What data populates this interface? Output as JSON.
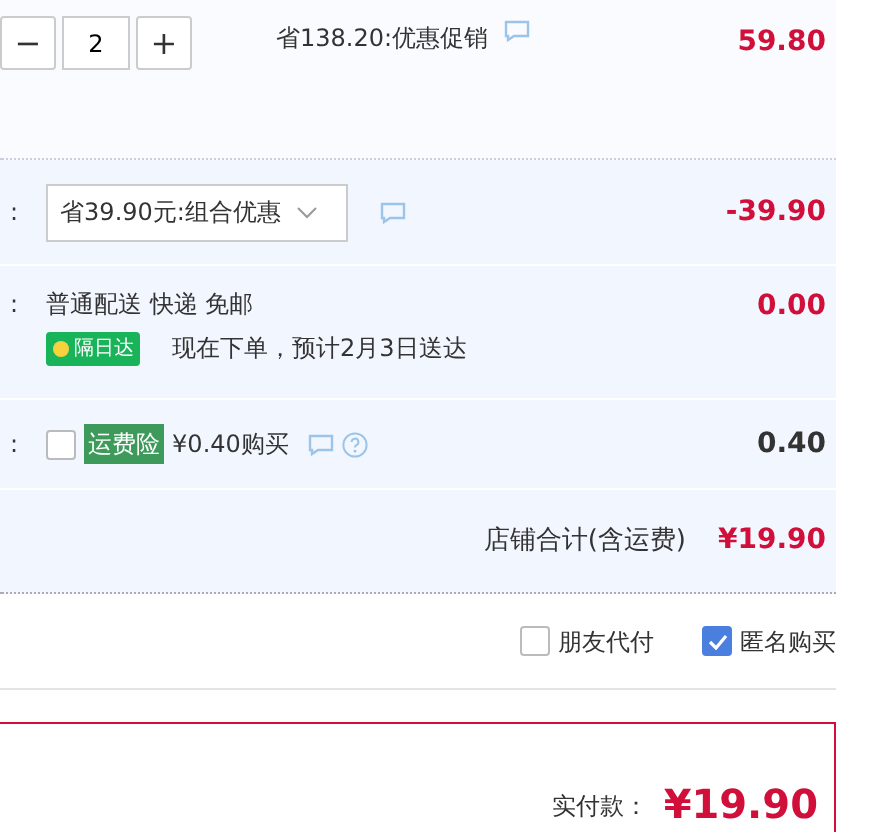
{
  "item": {
    "minus": "−",
    "quantity": "2",
    "plus": "+",
    "promo": "省138.20:优惠促销",
    "price": "59.80"
  },
  "combo": {
    "colon": ":",
    "selection": "省39.90元:组合优惠",
    "amount": "-39.90"
  },
  "delivery": {
    "colon": ":",
    "method": "普通配送 快递 免邮",
    "badge": "隔日达",
    "eta": "现在下单，预计2月3日送达",
    "amount": "0.00"
  },
  "insurance": {
    "colon": ":",
    "checked": false,
    "tag": "运费险",
    "offer": "¥0.40购买",
    "amount": "0.40"
  },
  "shop_total": {
    "label": "店铺合计(含运费)",
    "amount": "¥19.90"
  },
  "options": [
    {
      "label": "朋友代付",
      "checked": false
    },
    {
      "label": "匿名购买",
      "checked": true
    }
  ],
  "payable": {
    "label": "实付款：",
    "amount": "¥19.90"
  }
}
